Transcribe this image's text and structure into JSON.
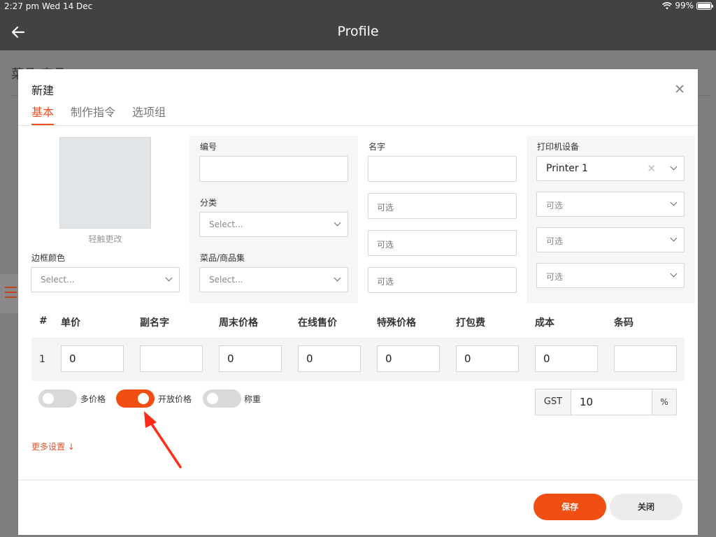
{
  "status_bar": {
    "time": "2:27 pm",
    "date": "Wed 14 Dec",
    "battery": "99%"
  },
  "header": {
    "title": "Profile"
  },
  "background_page": {
    "title": "菜品/商品"
  },
  "modal": {
    "title": "新建",
    "tabs": [
      {
        "label": "基本"
      },
      {
        "label": "制作指令"
      },
      {
        "label": "选项组"
      }
    ],
    "image_caption": "轻触更改",
    "border_color": {
      "label": "边框颜色",
      "placeholder": "Select..."
    },
    "code": {
      "label": "编号",
      "value": ""
    },
    "category": {
      "label": "分类",
      "placeholder": "Select..."
    },
    "dish_set": {
      "label": "菜品/商品集",
      "placeholder": "Select..."
    },
    "name": {
      "label": "名字",
      "value": "",
      "optional_fields": [
        "可选",
        "可选",
        "可选"
      ]
    },
    "printer": {
      "label": "打印机设备",
      "selected": "Printer 1",
      "optional_selects": [
        "可选",
        "可选",
        "可选"
      ]
    },
    "price_table": {
      "headers": [
        "#",
        "单价",
        "副名字",
        "周末价格",
        "在线售价",
        "特殊价格",
        "打包费",
        "成本",
        "条码"
      ],
      "rows": [
        {
          "index": "1",
          "cells": [
            "0",
            "",
            "0",
            "0",
            "0",
            "0",
            "0",
            ""
          ]
        }
      ]
    },
    "toggles": [
      {
        "label": "多价格",
        "on": false
      },
      {
        "label": "开放价格",
        "on": true
      },
      {
        "label": "称重",
        "on": false
      }
    ],
    "gst": {
      "label": "GST",
      "value": "10",
      "unit": "%"
    },
    "more_settings": "更多设置 ↓",
    "buttons": {
      "save": "保存",
      "close": "关闭"
    }
  },
  "colors": {
    "accent": "#f04e13",
    "header_bg": "#414244"
  }
}
